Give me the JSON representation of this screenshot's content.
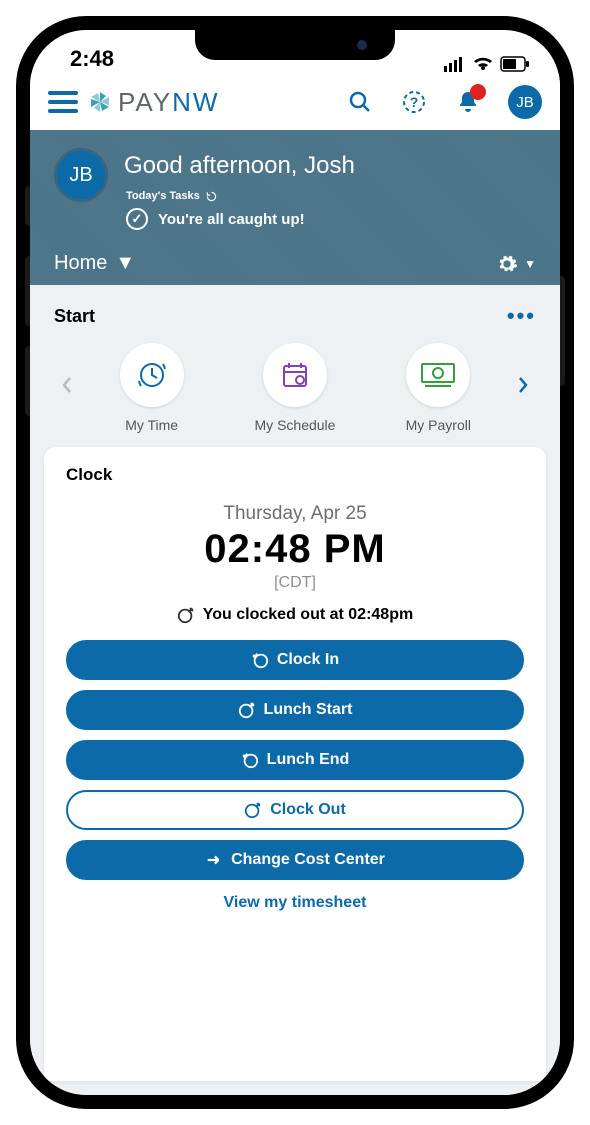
{
  "status": {
    "time": "2:48"
  },
  "user": {
    "initials": "JB"
  },
  "logo": {
    "brand_pay": "PAY",
    "brand_nw": "NW"
  },
  "banner": {
    "greeting": "Good afternoon, Josh",
    "tasks_label": "Today's Tasks",
    "caught_up": "You're all caught up!",
    "nav_label": "Home"
  },
  "start": {
    "title": "Start",
    "tiles": [
      {
        "label": "My Time"
      },
      {
        "label": "My Schedule"
      },
      {
        "label": "My Payroll"
      }
    ]
  },
  "clock": {
    "title": "Clock",
    "date": "Thursday, Apr 25",
    "time": "02:48 PM",
    "tz": "[CDT]",
    "status": "You clocked out at 02:48pm",
    "buttons": {
      "clock_in": "Clock In",
      "lunch_start": "Lunch Start",
      "lunch_end": "Lunch End",
      "clock_out": "Clock Out",
      "change_cc": "Change Cost Center"
    },
    "view_link": "View my timesheet"
  }
}
